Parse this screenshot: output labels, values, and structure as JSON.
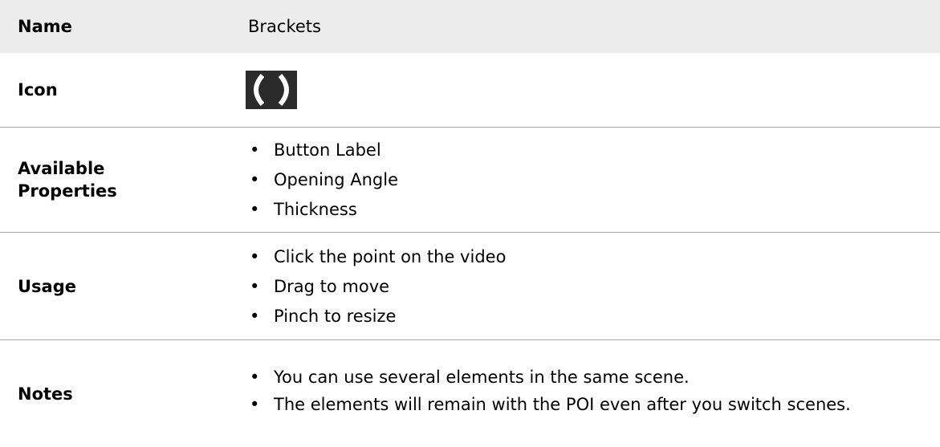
{
  "rows": {
    "name": {
      "label": "Name",
      "value": "Brackets"
    },
    "icon": {
      "label": "Icon",
      "icon_name": "brackets-icon"
    },
    "properties": {
      "label_line1": "Available",
      "label_line2": "Properties",
      "items": [
        "Button Label",
        "Opening Angle",
        "Thickness"
      ]
    },
    "usage": {
      "label": "Usage",
      "items": [
        "Click the point on the video",
        "Drag to move",
        "Pinch to resize"
      ]
    },
    "notes": {
      "label": "Notes",
      "items": [
        "You can use several elements in the same scene.",
        "The elements will remain with the POI even after you switch scenes."
      ]
    }
  },
  "bullet_char": "•",
  "colors": {
    "header_row_bg": "#ececec",
    "separator": "#a6a6a6",
    "icon_bg": "#2b2b2b",
    "icon_fg": "#ffffff"
  }
}
